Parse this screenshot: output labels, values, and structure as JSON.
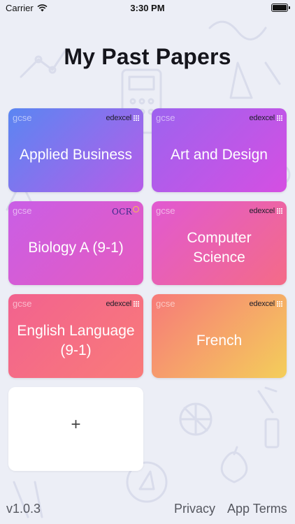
{
  "status_bar": {
    "carrier": "Carrier",
    "time": "3:30 PM"
  },
  "title": "My Past Papers",
  "cards": [
    {
      "level": "gcse",
      "board": "edexcel",
      "subject": "Applied Business"
    },
    {
      "level": "gcse",
      "board": "edexcel",
      "subject": "Art and Design"
    },
    {
      "level": "gcse",
      "board": "OCR",
      "subject": "Biology A (9-1)"
    },
    {
      "level": "gcse",
      "board": "edexcel",
      "subject": "Computer Science"
    },
    {
      "level": "gcse",
      "board": "edexcel",
      "subject": "English Language (9-1)"
    },
    {
      "level": "gcse",
      "board": "edexcel",
      "subject": "French"
    }
  ],
  "add_card": {
    "label": "+"
  },
  "footer": {
    "version": "v1.0.3",
    "privacy": "Privacy",
    "terms": "App Terms"
  },
  "colors": {
    "background": "#eceef6",
    "card_gradients": [
      [
        "#5a86f2",
        "#b65de9"
      ],
      [
        "#9d63ef",
        "#d54fe2"
      ],
      [
        "#c95ee6",
        "#e65bbf"
      ],
      [
        "#e159d2",
        "#f46b87"
      ],
      [
        "#f2628f",
        "#f97b79"
      ],
      [
        "#f77a79",
        "#f4ce5a"
      ]
    ]
  }
}
